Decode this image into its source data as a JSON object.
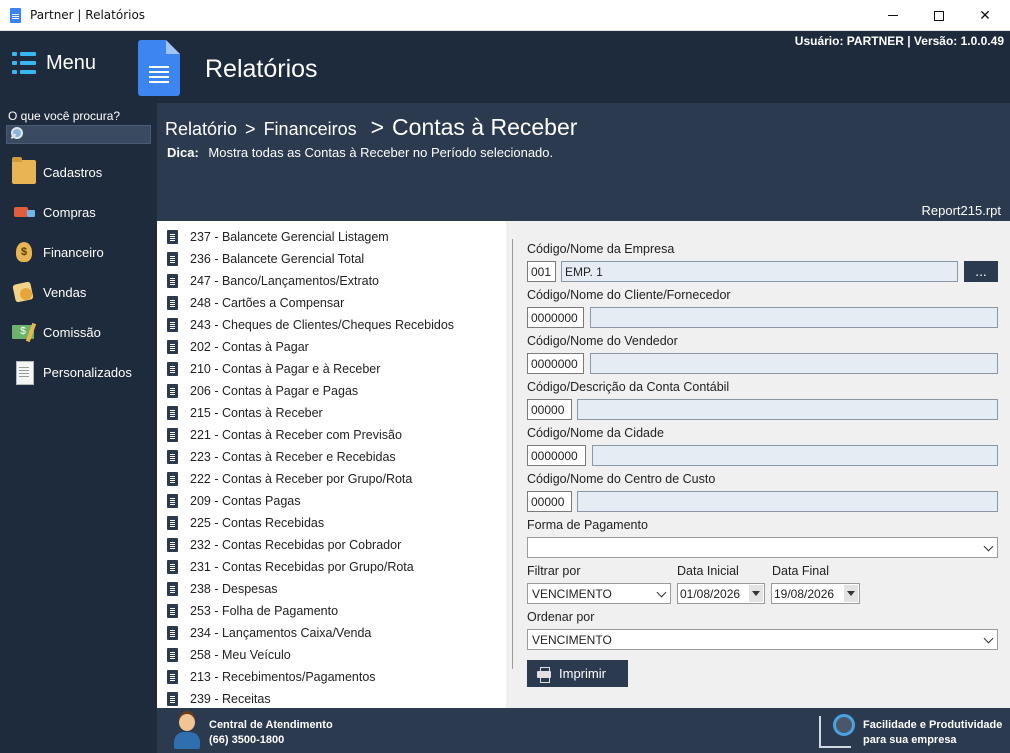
{
  "window": {
    "title": "Partner | Relatórios"
  },
  "header": {
    "menu_label": "Menu",
    "title": "Relatórios",
    "user_info": "Usuário: PARTNER | Versão: 1.0.0.49"
  },
  "sidebar": {
    "search_label": "O que você procura?",
    "items": [
      {
        "label": "Cadastros",
        "icon": "folder-icon"
      },
      {
        "label": "Compras",
        "icon": "truck-icon"
      },
      {
        "label": "Financeiro",
        "icon": "money-bag-icon"
      },
      {
        "label": "Vendas",
        "icon": "sales-icon"
      },
      {
        "label": "Comissão",
        "icon": "commission-icon"
      },
      {
        "label": "Personalizados",
        "icon": "document-icon"
      }
    ]
  },
  "content": {
    "breadcrumb_1": "Relatório",
    "sep_1": ">",
    "breadcrumb_2": "Financeiros",
    "sep_2": ">",
    "breadcrumb_current": "Contas à Receber",
    "tip_label": "Dica:",
    "tip_text": "Mostra todas as Contas à Receber no Período selecionado.",
    "report_file": "Report215.rpt"
  },
  "reports": [
    "237 - Balancete Gerencial Listagem",
    "236 - Balancete Gerencial Total",
    "247 - Banco/Lançamentos/Extrato",
    "248 - Cartões a Compensar",
    "243 - Cheques de Clientes/Cheques Recebidos",
    "202 - Contas à Pagar",
    "210 - Contas à Pagar e à Receber",
    "206 - Contas à Pagar e Pagas",
    "215 - Contas à Receber",
    "221 - Contas à Receber com Previsão",
    "223 - Contas à Receber e Recebidas",
    "222 - Contas à Receber por Grupo/Rota",
    "209 - Contas Pagas",
    "225 - Contas Recebidas",
    "232 - Contas Recebidas por Cobrador",
    "231 - Contas Recebidas por Grupo/Rota",
    "238 - Despesas",
    "253 - Folha de Pagamento",
    "234 - Lançamentos Caixa/Venda",
    "258 - Meu Veículo",
    "213 - Recebimentos/Pagamentos",
    "239 - Receitas"
  ],
  "form": {
    "empresa": {
      "label": "Código/Nome da Empresa",
      "code": "001",
      "name": "EMP. 1",
      "browse": "..."
    },
    "cliente": {
      "label": "Código/Nome do Cliente/Fornecedor",
      "code": "0000000",
      "name": ""
    },
    "vendedor": {
      "label": "Código/Nome do Vendedor",
      "code": "0000000",
      "name": ""
    },
    "conta": {
      "label": "Código/Descrição da Conta Contábil",
      "code": "00000",
      "name": ""
    },
    "cidade": {
      "label": "Código/Nome da Cidade",
      "code": "0000000",
      "name": ""
    },
    "centro": {
      "label": "Código/Nome do Centro de Custo",
      "code": "00000",
      "name": ""
    },
    "pagamento": {
      "label": "Forma de Pagamento",
      "value": ""
    },
    "filtrar": {
      "label": "Filtrar por",
      "value": "VENCIMENTO"
    },
    "data_inicial": {
      "label": "Data Inicial",
      "value": "01/08/2026"
    },
    "data_final": {
      "label": "Data Final",
      "value": "19/08/2026"
    },
    "ordenar": {
      "label": "Ordenar por",
      "value": "VENCIMENTO"
    },
    "print_label": "Imprimir"
  },
  "footer": {
    "support_title": "Central de Atendimento",
    "support_phone": "(66) 3500-1800",
    "slogan_1": "Facilidade e Produtividade",
    "slogan_2": "para sua empresa"
  },
  "colors": {
    "header_bg": "#1e2b3c",
    "panel_bg": "#2b3a4f",
    "accent": "#37b8f0"
  }
}
